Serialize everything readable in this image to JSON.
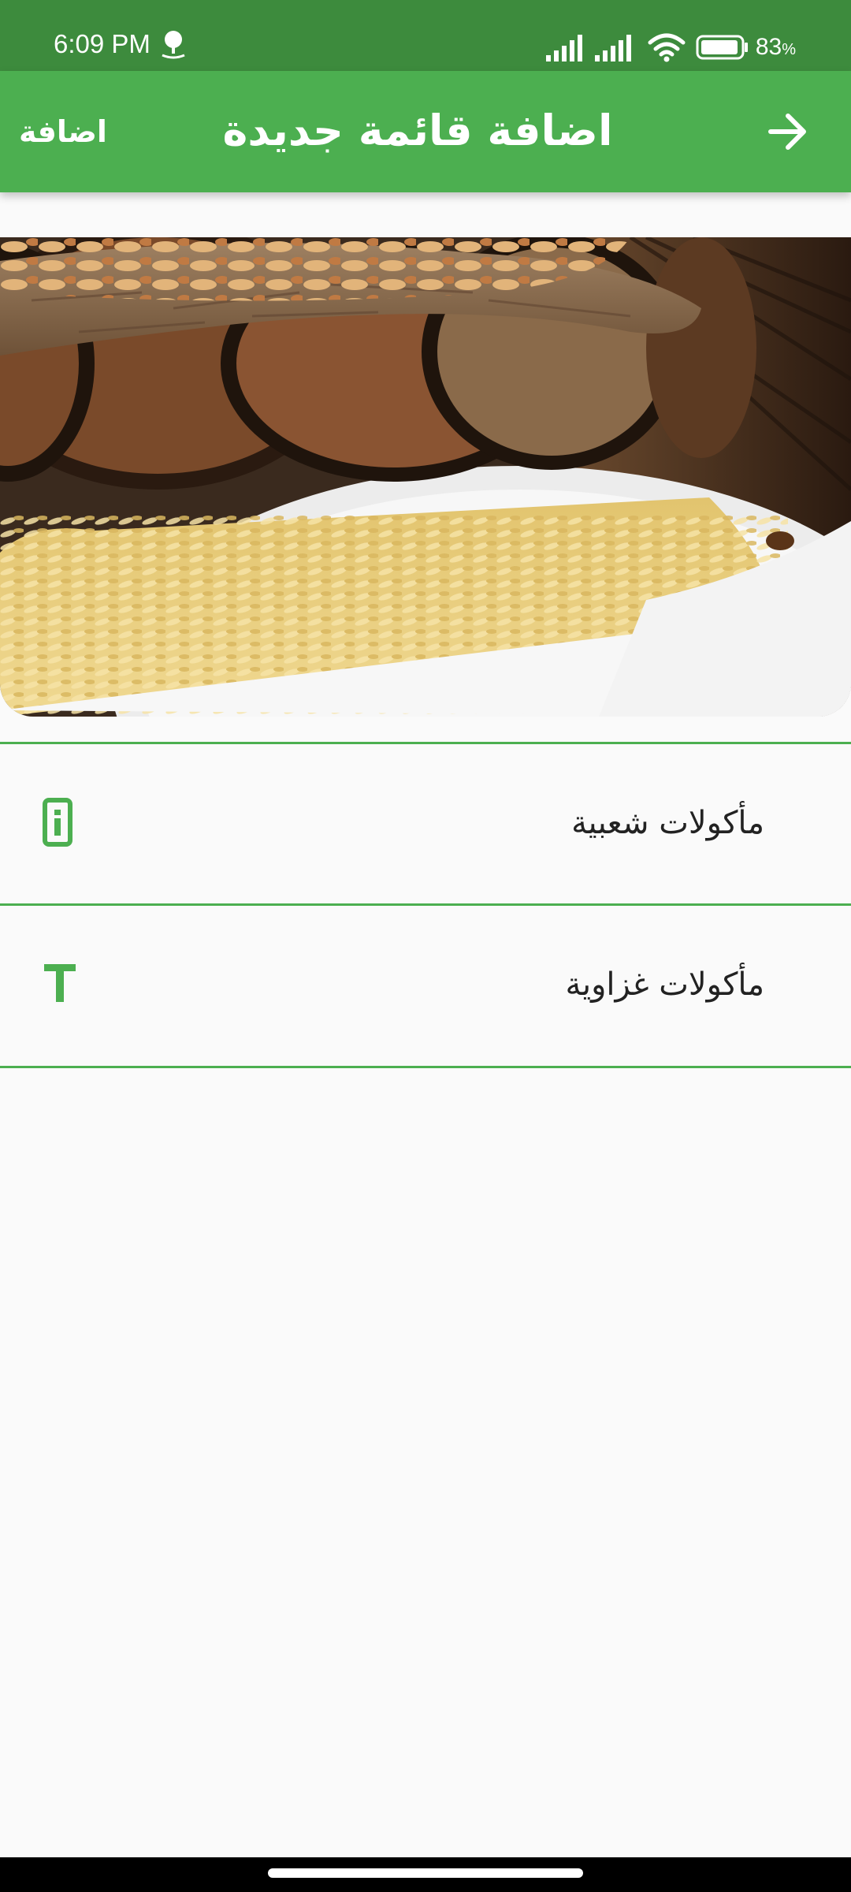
{
  "status_bar": {
    "time": "6:09 PM",
    "battery_value": "83",
    "battery_unit": "%",
    "icons": [
      "notification-icon",
      "signal-icon",
      "signal-icon",
      "wifi-icon",
      "battery-icon"
    ]
  },
  "app_bar": {
    "title": "اضافة قائمة جديدة",
    "action_label": "اضافة",
    "forward_icon": "arrow-forward-icon"
  },
  "hero": {
    "icon": "food-photo"
  },
  "list": {
    "items": [
      {
        "label": "مأكولات شعبية",
        "icon": "info-box-icon"
      },
      {
        "label": "مأكولات غزاوية",
        "icon": "text-t-icon"
      }
    ]
  },
  "colors": {
    "status_bar": "#3d8b3d",
    "app_bar": "#4caf50",
    "accent": "#4caf50",
    "background": "#fafafa",
    "text": "#222222"
  }
}
